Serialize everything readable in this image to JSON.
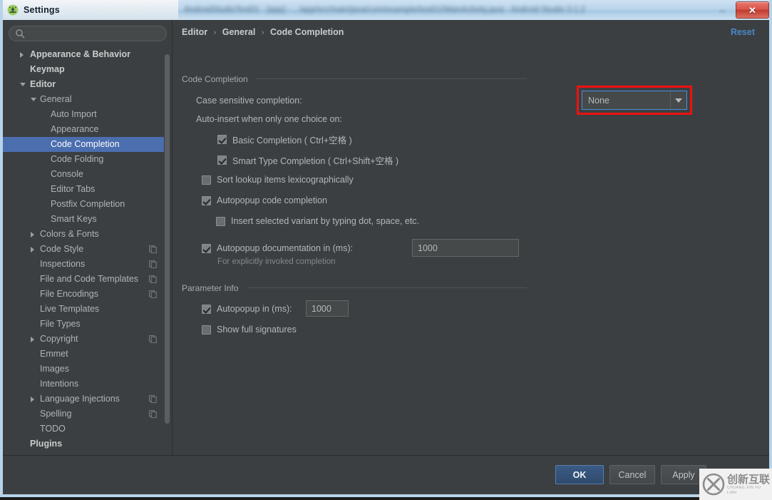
{
  "background_window": {
    "blurred_title": "AndroidStudioTest01 - [app] - .../app/src/main/java/com/example/test01/MainActivity.java - Android Studio 3.1.2",
    "minimize_icon": "minimize-icon"
  },
  "titlebar": {
    "title": "Settings",
    "app_icon": "android-studio-icon",
    "close_label": "✕",
    "close_icon": "close-icon"
  },
  "sidebar": {
    "search": {
      "value": "",
      "placeholder": "",
      "icon": "search-icon"
    },
    "items": [
      {
        "label": "Appearance & Behavior",
        "level": 0,
        "arrow": "collapsed",
        "bold": true,
        "selected": false,
        "badge": false
      },
      {
        "label": "Keymap",
        "level": 0,
        "arrow": "none",
        "bold": true,
        "selected": false,
        "badge": false
      },
      {
        "label": "Editor",
        "level": 0,
        "arrow": "expanded",
        "bold": true,
        "selected": false,
        "badge": false
      },
      {
        "label": "General",
        "level": 1,
        "arrow": "expanded",
        "bold": false,
        "selected": false,
        "badge": false
      },
      {
        "label": "Auto Import",
        "level": 2,
        "arrow": "none",
        "bold": false,
        "selected": false,
        "badge": false
      },
      {
        "label": "Appearance",
        "level": 2,
        "arrow": "none",
        "bold": false,
        "selected": false,
        "badge": false
      },
      {
        "label": "Code Completion",
        "level": 2,
        "arrow": "none",
        "bold": false,
        "selected": true,
        "badge": false
      },
      {
        "label": "Code Folding",
        "level": 2,
        "arrow": "none",
        "bold": false,
        "selected": false,
        "badge": false
      },
      {
        "label": "Console",
        "level": 2,
        "arrow": "none",
        "bold": false,
        "selected": false,
        "badge": false
      },
      {
        "label": "Editor Tabs",
        "level": 2,
        "arrow": "none",
        "bold": false,
        "selected": false,
        "badge": false
      },
      {
        "label": "Postfix Completion",
        "level": 2,
        "arrow": "none",
        "bold": false,
        "selected": false,
        "badge": false
      },
      {
        "label": "Smart Keys",
        "level": 2,
        "arrow": "none",
        "bold": false,
        "selected": false,
        "badge": false
      },
      {
        "label": "Colors & Fonts",
        "level": 1,
        "arrow": "collapsed",
        "bold": false,
        "selected": false,
        "badge": false
      },
      {
        "label": "Code Style",
        "level": 1,
        "arrow": "collapsed",
        "bold": false,
        "selected": false,
        "badge": true
      },
      {
        "label": "Inspections",
        "level": 1,
        "arrow": "none",
        "bold": false,
        "selected": false,
        "badge": true
      },
      {
        "label": "File and Code Templates",
        "level": 1,
        "arrow": "none",
        "bold": false,
        "selected": false,
        "badge": true
      },
      {
        "label": "File Encodings",
        "level": 1,
        "arrow": "none",
        "bold": false,
        "selected": false,
        "badge": true
      },
      {
        "label": "Live Templates",
        "level": 1,
        "arrow": "none",
        "bold": false,
        "selected": false,
        "badge": false
      },
      {
        "label": "File Types",
        "level": 1,
        "arrow": "none",
        "bold": false,
        "selected": false,
        "badge": false
      },
      {
        "label": "Copyright",
        "level": 1,
        "arrow": "collapsed",
        "bold": false,
        "selected": false,
        "badge": true
      },
      {
        "label": "Emmet",
        "level": 1,
        "arrow": "none",
        "bold": false,
        "selected": false,
        "badge": false
      },
      {
        "label": "Images",
        "level": 1,
        "arrow": "none",
        "bold": false,
        "selected": false,
        "badge": false
      },
      {
        "label": "Intentions",
        "level": 1,
        "arrow": "none",
        "bold": false,
        "selected": false,
        "badge": false
      },
      {
        "label": "Language Injections",
        "level": 1,
        "arrow": "collapsed",
        "bold": false,
        "selected": false,
        "badge": true
      },
      {
        "label": "Spelling",
        "level": 1,
        "arrow": "none",
        "bold": false,
        "selected": false,
        "badge": true
      },
      {
        "label": "TODO",
        "level": 1,
        "arrow": "none",
        "bold": false,
        "selected": false,
        "badge": false
      },
      {
        "label": "Plugins",
        "level": 0,
        "arrow": "none",
        "bold": true,
        "selected": false,
        "badge": false
      }
    ]
  },
  "content": {
    "breadcrumb": {
      "part1": "Editor",
      "part2": "General",
      "part3": "Code Completion",
      "separator": "›"
    },
    "reset_label": "Reset",
    "section_code_completion": {
      "title": "Code Completion",
      "case_sensitive_label": "Case sensitive completion:",
      "case_sensitive_value": "None",
      "auto_insert_label": "Auto-insert when only one choice on:",
      "basic_completion": {
        "label": "Basic Completion ( Ctrl+空格 )",
        "checked": true
      },
      "smart_type_completion": {
        "label": "Smart Type Completion ( Ctrl+Shift+空格 )",
        "checked": true
      },
      "sort_lookup": {
        "label": "Sort lookup items lexicographically",
        "checked": false
      },
      "autopopup_code_completion": {
        "label": "Autopopup code completion",
        "checked": true
      },
      "insert_selected_variant": {
        "label": "Insert selected variant by typing dot, space, etc.",
        "checked": false
      },
      "autopopup_documentation": {
        "label": "Autopopup documentation in (ms):",
        "checked": true,
        "value": "1000"
      },
      "autopopup_doc_hint": "For explicitly invoked completion"
    },
    "section_parameter_info": {
      "title": "Parameter Info",
      "autopopup": {
        "label": "Autopopup in (ms):",
        "checked": true,
        "value": "1000"
      },
      "show_full_signatures": {
        "label": "Show full signatures",
        "checked": false
      }
    }
  },
  "footer": {
    "ok_label": "OK",
    "cancel_label": "Cancel",
    "apply_label": "Apply"
  },
  "watermark": {
    "cn_text": "创新互联",
    "en_text": "CHUANG XIN HU LIAN",
    "logo_icon": "x-circle-logo-icon"
  },
  "annotation": {
    "highlight_color": "#ee1111",
    "focus_color": "#4a90d9",
    "accent_color": "#4b6eaf"
  }
}
